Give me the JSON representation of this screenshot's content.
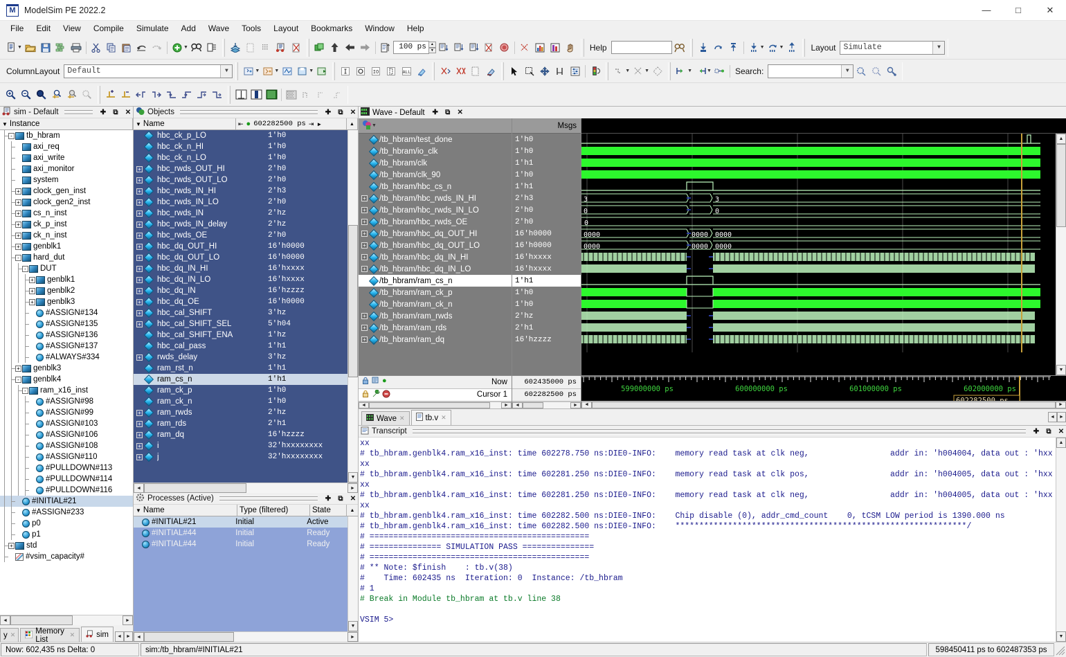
{
  "window": {
    "title": "ModelSim PE 2022.2",
    "minimize": "—",
    "maximize": "□",
    "close": "✕"
  },
  "menu": [
    "File",
    "Edit",
    "View",
    "Compile",
    "Simulate",
    "Add",
    "Wave",
    "Tools",
    "Layout",
    "Bookmarks",
    "Window",
    "Help"
  ],
  "toolbar": {
    "help_label": "Help",
    "help_value": "",
    "columnlayout_label": "ColumnLayout",
    "columnlayout_value": "Default",
    "run_length_value": "100 ps",
    "layout_label": "Layout",
    "layout_value": "Simulate",
    "search_label": "Search:",
    "search_value": ""
  },
  "sim_panel": {
    "title": "sim - Default",
    "column_header": "Instance",
    "rows": [
      {
        "label": "tb_hbram",
        "indent": 0,
        "box": "-",
        "icon": "module"
      },
      {
        "label": "axi_req",
        "indent": 1,
        "box": "",
        "icon": "module"
      },
      {
        "label": "axi_write",
        "indent": 1,
        "box": "",
        "icon": "module"
      },
      {
        "label": "axi_monitor",
        "indent": 1,
        "box": "",
        "icon": "module"
      },
      {
        "label": "system",
        "indent": 1,
        "box": "",
        "icon": "module"
      },
      {
        "label": "clock_gen_inst",
        "indent": 1,
        "box": "+",
        "icon": "module"
      },
      {
        "label": "clock_gen2_inst",
        "indent": 1,
        "box": "+",
        "icon": "module"
      },
      {
        "label": "cs_n_inst",
        "indent": 1,
        "box": "+",
        "icon": "module"
      },
      {
        "label": "ck_p_inst",
        "indent": 1,
        "box": "+",
        "icon": "module"
      },
      {
        "label": "ck_n_inst",
        "indent": 1,
        "box": "+",
        "icon": "module"
      },
      {
        "label": "genblk1",
        "indent": 1,
        "box": "+",
        "icon": "module"
      },
      {
        "label": "hard_dut",
        "indent": 1,
        "box": "-",
        "icon": "module"
      },
      {
        "label": "DUT",
        "indent": 2,
        "box": "-",
        "icon": "module"
      },
      {
        "label": "genblk1",
        "indent": 3,
        "box": "+",
        "icon": "module"
      },
      {
        "label": "genblk2",
        "indent": 3,
        "box": "+",
        "icon": "module"
      },
      {
        "label": "genblk3",
        "indent": 3,
        "box": "+",
        "icon": "module"
      },
      {
        "label": "#ASSIGN#134",
        "indent": 3,
        "box": "",
        "icon": "proc"
      },
      {
        "label": "#ASSIGN#135",
        "indent": 3,
        "box": "",
        "icon": "proc"
      },
      {
        "label": "#ASSIGN#136",
        "indent": 3,
        "box": "",
        "icon": "proc"
      },
      {
        "label": "#ASSIGN#137",
        "indent": 3,
        "box": "",
        "icon": "proc"
      },
      {
        "label": "#ALWAYS#334",
        "indent": 3,
        "box": "",
        "icon": "proc"
      },
      {
        "label": "genblk3",
        "indent": 1,
        "box": "+",
        "icon": "module"
      },
      {
        "label": "genblk4",
        "indent": 1,
        "box": "-",
        "icon": "module"
      },
      {
        "label": "ram_x16_inst",
        "indent": 2,
        "box": "-",
        "icon": "module"
      },
      {
        "label": "#ASSIGN#98",
        "indent": 3,
        "box": "",
        "icon": "proc"
      },
      {
        "label": "#ASSIGN#99",
        "indent": 3,
        "box": "",
        "icon": "proc"
      },
      {
        "label": "#ASSIGN#103",
        "indent": 3,
        "box": "",
        "icon": "proc"
      },
      {
        "label": "#ASSIGN#106",
        "indent": 3,
        "box": "",
        "icon": "proc"
      },
      {
        "label": "#ASSIGN#108",
        "indent": 3,
        "box": "",
        "icon": "proc"
      },
      {
        "label": "#ASSIGN#110",
        "indent": 3,
        "box": "",
        "icon": "proc"
      },
      {
        "label": "#PULLDOWN#113",
        "indent": 3,
        "box": "",
        "icon": "proc"
      },
      {
        "label": "#PULLDOWN#114",
        "indent": 3,
        "box": "",
        "icon": "proc"
      },
      {
        "label": "#PULLDOWN#116",
        "indent": 3,
        "box": "",
        "icon": "proc"
      },
      {
        "label": "#INITIAL#21",
        "indent": 1,
        "box": "",
        "icon": "proc",
        "selected": true
      },
      {
        "label": "#ASSIGN#233",
        "indent": 1,
        "box": "",
        "icon": "proc"
      },
      {
        "label": "p0",
        "indent": 1,
        "box": "",
        "icon": "proc"
      },
      {
        "label": "p1",
        "indent": 1,
        "box": "",
        "icon": "proc"
      },
      {
        "label": "std",
        "indent": 0,
        "box": "+",
        "icon": "module"
      },
      {
        "label": "#vsim_capacity#",
        "indent": 0,
        "box": "",
        "icon": "cap"
      }
    ]
  },
  "objects_panel": {
    "title": "Objects",
    "column_header": "Name",
    "time_value": "602282500 ps",
    "rows": [
      {
        "name": "hbc_ck_p_LO",
        "value": "1'h0",
        "box": ""
      },
      {
        "name": "hbc_ck_n_HI",
        "value": "1'h0",
        "box": ""
      },
      {
        "name": "hbc_ck_n_LO",
        "value": "1'h0",
        "box": ""
      },
      {
        "name": "hbc_rwds_OUT_HI",
        "value": "2'h0",
        "box": "+"
      },
      {
        "name": "hbc_rwds_OUT_LO",
        "value": "2'h0",
        "box": "+"
      },
      {
        "name": "hbc_rwds_IN_HI",
        "value": "2'h3",
        "box": "+"
      },
      {
        "name": "hbc_rwds_IN_LO",
        "value": "2'h0",
        "box": "+"
      },
      {
        "name": "hbc_rwds_IN",
        "value": "2'hz",
        "box": "+"
      },
      {
        "name": "hbc_rwds_IN_delay",
        "value": "2'hz",
        "box": "+"
      },
      {
        "name": "hbc_rwds_OE",
        "value": "2'h0",
        "box": "+"
      },
      {
        "name": "hbc_dq_OUT_HI",
        "value": "16'h0000",
        "box": "+"
      },
      {
        "name": "hbc_dq_OUT_LO",
        "value": "16'h0000",
        "box": "+"
      },
      {
        "name": "hbc_dq_IN_HI",
        "value": "16'hxxxx",
        "box": "+"
      },
      {
        "name": "hbc_dq_IN_LO",
        "value": "16'hxxxx",
        "box": "+"
      },
      {
        "name": "hbc_dq_IN",
        "value": "16'hzzzz",
        "box": "+"
      },
      {
        "name": "hbc_dq_OE",
        "value": "16'h0000",
        "box": "+"
      },
      {
        "name": "hbc_cal_SHIFT",
        "value": "3'hz",
        "box": "+"
      },
      {
        "name": "hbc_cal_SHIFT_SEL",
        "value": "5'h04",
        "box": "+"
      },
      {
        "name": "hbc_cal_SHIFT_ENA",
        "value": "1'hz",
        "box": ""
      },
      {
        "name": "hbc_cal_pass",
        "value": "1'h1",
        "box": ""
      },
      {
        "name": "rwds_delay",
        "value": "3'hz",
        "box": "+"
      },
      {
        "name": "ram_rst_n",
        "value": "1'h1",
        "box": ""
      },
      {
        "name": "ram_cs_n",
        "value": "1'h1",
        "box": "",
        "selected": true
      },
      {
        "name": "ram_ck_p",
        "value": "1'h0",
        "box": ""
      },
      {
        "name": "ram_ck_n",
        "value": "1'h0",
        "box": ""
      },
      {
        "name": "ram_rwds",
        "value": "2'hz",
        "box": "+"
      },
      {
        "name": "ram_rds",
        "value": "2'h1",
        "box": "+"
      },
      {
        "name": "ram_dq",
        "value": "16'hzzzz",
        "box": "+"
      },
      {
        "name": "i",
        "value": "32'hxxxxxxxx",
        "box": "+"
      },
      {
        "name": "j",
        "value": "32'hxxxxxxxx",
        "box": "+"
      }
    ]
  },
  "processes_panel": {
    "title": "Processes (Active)",
    "columns": [
      "Name",
      "Type (filtered)",
      "State"
    ],
    "rows": [
      {
        "name": "#INITIAL#21",
        "type": "Initial",
        "state": "Active",
        "selected": true
      },
      {
        "name": "#INITIAL#44",
        "type": "Initial",
        "state": "Ready"
      },
      {
        "name": "#INITIAL#44",
        "type": "Initial",
        "state": "Ready"
      }
    ]
  },
  "wave_panel": {
    "title": "Wave - Default",
    "msgs_header": "Msgs",
    "signals": [
      {
        "name": "/tb_hbram/test_done",
        "value": "1'h0",
        "box": "",
        "type": "bit",
        "level": "low"
      },
      {
        "name": "/tb_hbram/io_clk",
        "value": "1'h0",
        "box": "",
        "type": "bit",
        "level": "high"
      },
      {
        "name": "/tb_hbram/clk",
        "value": "1'h1",
        "box": "",
        "type": "bit",
        "level": "high"
      },
      {
        "name": "/tb_hbram/clk_90",
        "value": "1'h0",
        "box": "",
        "type": "bit",
        "level": "high"
      },
      {
        "name": "/tb_hbram/hbc_cs_n",
        "value": "1'h1",
        "box": "",
        "type": "bit",
        "level": "pulse"
      },
      {
        "name": "/tb_hbram/hbc_rwds_IN_HI",
        "value": "2'h3",
        "box": "+",
        "type": "bus",
        "bus_values": [
          "3",
          "",
          "3"
        ]
      },
      {
        "name": "/tb_hbram/hbc_rwds_IN_LO",
        "value": "2'h0",
        "box": "+",
        "type": "bus",
        "bus_values": [
          "0",
          "",
          "0"
        ]
      },
      {
        "name": "/tb_hbram/hbc_rwds_OE",
        "value": "2'h0",
        "box": "+",
        "type": "bus",
        "bus_values": [
          "0"
        ]
      },
      {
        "name": "/tb_hbram/hbc_dq_OUT_HI",
        "value": "16'h0000",
        "box": "+",
        "type": "bus",
        "bus_values": [
          "0000",
          "0000",
          "0000"
        ]
      },
      {
        "name": "/tb_hbram/hbc_dq_OUT_LO",
        "value": "16'h0000",
        "box": "+",
        "type": "bus",
        "bus_values": [
          "0000",
          "0000",
          "0000"
        ]
      },
      {
        "name": "/tb_hbram/hbc_dq_IN_HI",
        "value": "16'hxxxx",
        "box": "+",
        "type": "busx",
        "dense": true
      },
      {
        "name": "/tb_hbram/hbc_dq_IN_LO",
        "value": "16'hxxxx",
        "box": "+",
        "type": "busx",
        "dense": false
      },
      {
        "name": "/tb_hbram/ram_cs_n",
        "value": "1'h1",
        "box": "",
        "type": "bit",
        "level": "pulse",
        "selected": true
      },
      {
        "name": "/tb_hbram/ram_ck_p",
        "value": "1'h0",
        "box": "",
        "type": "bit",
        "level": "gap"
      },
      {
        "name": "/tb_hbram/ram_ck_n",
        "value": "1'h0",
        "box": "",
        "type": "bit",
        "level": "gap"
      },
      {
        "name": "/tb_hbram/ram_rwds",
        "value": "2'hz",
        "box": "+",
        "type": "busz",
        "dense": false
      },
      {
        "name": "/tb_hbram/ram_rds",
        "value": "2'h1",
        "box": "+",
        "type": "busz",
        "dense": false
      },
      {
        "name": "/tb_hbram/ram_dq",
        "value": "16'hzzzz",
        "box": "+",
        "type": "busz",
        "dense": true
      }
    ],
    "now_label": "Now",
    "now_value": "602435000 ps",
    "cursor_label": "Cursor 1",
    "cursor_value": "602282500 ps",
    "cursor_marker": "602282500 ps",
    "ruler_ticks": [
      "599000000 ps",
      "600000000 ps",
      "601000000 ps",
      "602000000 ps"
    ],
    "tabs": [
      {
        "label": "Wave",
        "active": false
      },
      {
        "label": "tb.v",
        "active": true
      }
    ]
  },
  "transcript": {
    "title": "Transcript",
    "lines": [
      {
        "text": "xx",
        "color": "blue"
      },
      {
        "text": "# tb_hbram.genblk4.ram_x16_inst: time 602278.750 ns:DIE0-INFO:    memory read task at clk neg,                 addr in: 'h004004, data out : 'hxx",
        "color": "blue"
      },
      {
        "text": "xx",
        "color": "blue"
      },
      {
        "text": "# tb_hbram.genblk4.ram_x16_inst: time 602281.250 ns:DIE0-INFO:    memory read task at clk pos,                 addr in: 'h004005, data out : 'hxx",
        "color": "blue"
      },
      {
        "text": "xx",
        "color": "blue"
      },
      {
        "text": "# tb_hbram.genblk4.ram_x16_inst: time 602281.250 ns:DIE0-INFO:    memory read task at clk neg,                 addr in: 'h004005, data out : 'hxx",
        "color": "blue"
      },
      {
        "text": "xx",
        "color": "blue"
      },
      {
        "text": "# tb_hbram.genblk4.ram_x16_inst: time 602282.500 ns:DIE0-INFO:    Chip disable (0), addr_cmd_count    0, tCSM LOW period is 1390.000 ns",
        "color": "blue"
      },
      {
        "text": "# tb_hbram.genblk4.ram_x16_inst: time 602282.500 ns:DIE0-INFO:    *************************************************************/",
        "color": "blue"
      },
      {
        "text": "# ==============================================",
        "color": "blue"
      },
      {
        "text": "# =============== SIMULATION PASS ===============",
        "color": "blue"
      },
      {
        "text": "# ==============================================",
        "color": "blue"
      },
      {
        "text": "# ** Note: $finish    : tb.v(38)",
        "color": "blue"
      },
      {
        "text": "#    Time: 602435 ns  Iteration: 0  Instance: /tb_hbram",
        "color": "blue"
      },
      {
        "text": "# 1",
        "color": "blue"
      },
      {
        "text": "# Break in Module tb_hbram at tb.v line 38",
        "color": "green"
      },
      {
        "text": "",
        "color": "blue"
      },
      {
        "text": "VSIM 5>",
        "color": "blue"
      }
    ]
  },
  "bottom_tabs": [
    {
      "label": "y",
      "active": false
    },
    {
      "label": "Memory List",
      "active": false
    },
    {
      "label": "sim",
      "active": true
    }
  ],
  "statusbar": {
    "now": "Now: 602,435 ns  Delta: 0",
    "context": "sim:/tb_hbram/#INITIAL#21",
    "range": "598450411 ps to 602487353 ps"
  },
  "colors": {
    "wave_bg": "#000000",
    "wave_green": "#2df82d",
    "wave_pale": "#bdf5bd",
    "objects_bg": "#3f5387",
    "selection": "#c8d8ea",
    "cursor": "#c8a13a"
  }
}
